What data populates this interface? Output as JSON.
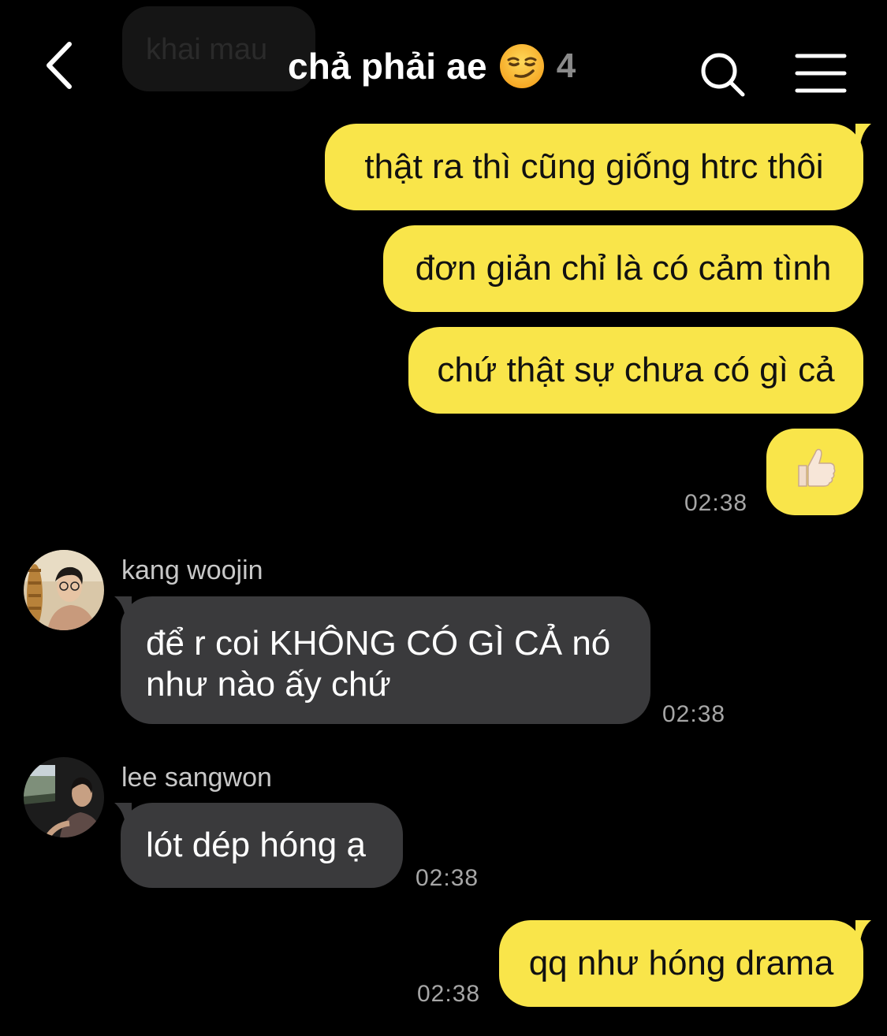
{
  "faded_message": {
    "text": "khai mau"
  },
  "header": {
    "title": "chả phải ae",
    "emoji_icon": "smirking-face",
    "member_count": "4"
  },
  "messages": [
    {
      "side": "me",
      "text": "thật ra thì cũng giống htrc thôi"
    },
    {
      "side": "me",
      "text": "đơn giản chỉ là có cảm tình"
    },
    {
      "side": "me",
      "text": "chứ thật sự chưa có gì cả"
    },
    {
      "side": "me",
      "icon": "thumbs-up",
      "time": "02:38"
    },
    {
      "side": "other",
      "sender": "kang woojin",
      "text": "để r coi KHÔNG CÓ GÌ CẢ nó như nào ấy chứ",
      "time": "02:38"
    },
    {
      "side": "other",
      "sender": "lee sangwon",
      "text": "lót dép hóng ạ",
      "time": "02:38"
    },
    {
      "side": "me",
      "text": "qq như hóng drama",
      "time": "02:38"
    }
  ],
  "colors": {
    "my_bubble": "#f9e54a",
    "other_bubble": "#3a3a3c",
    "background": "#000000"
  }
}
